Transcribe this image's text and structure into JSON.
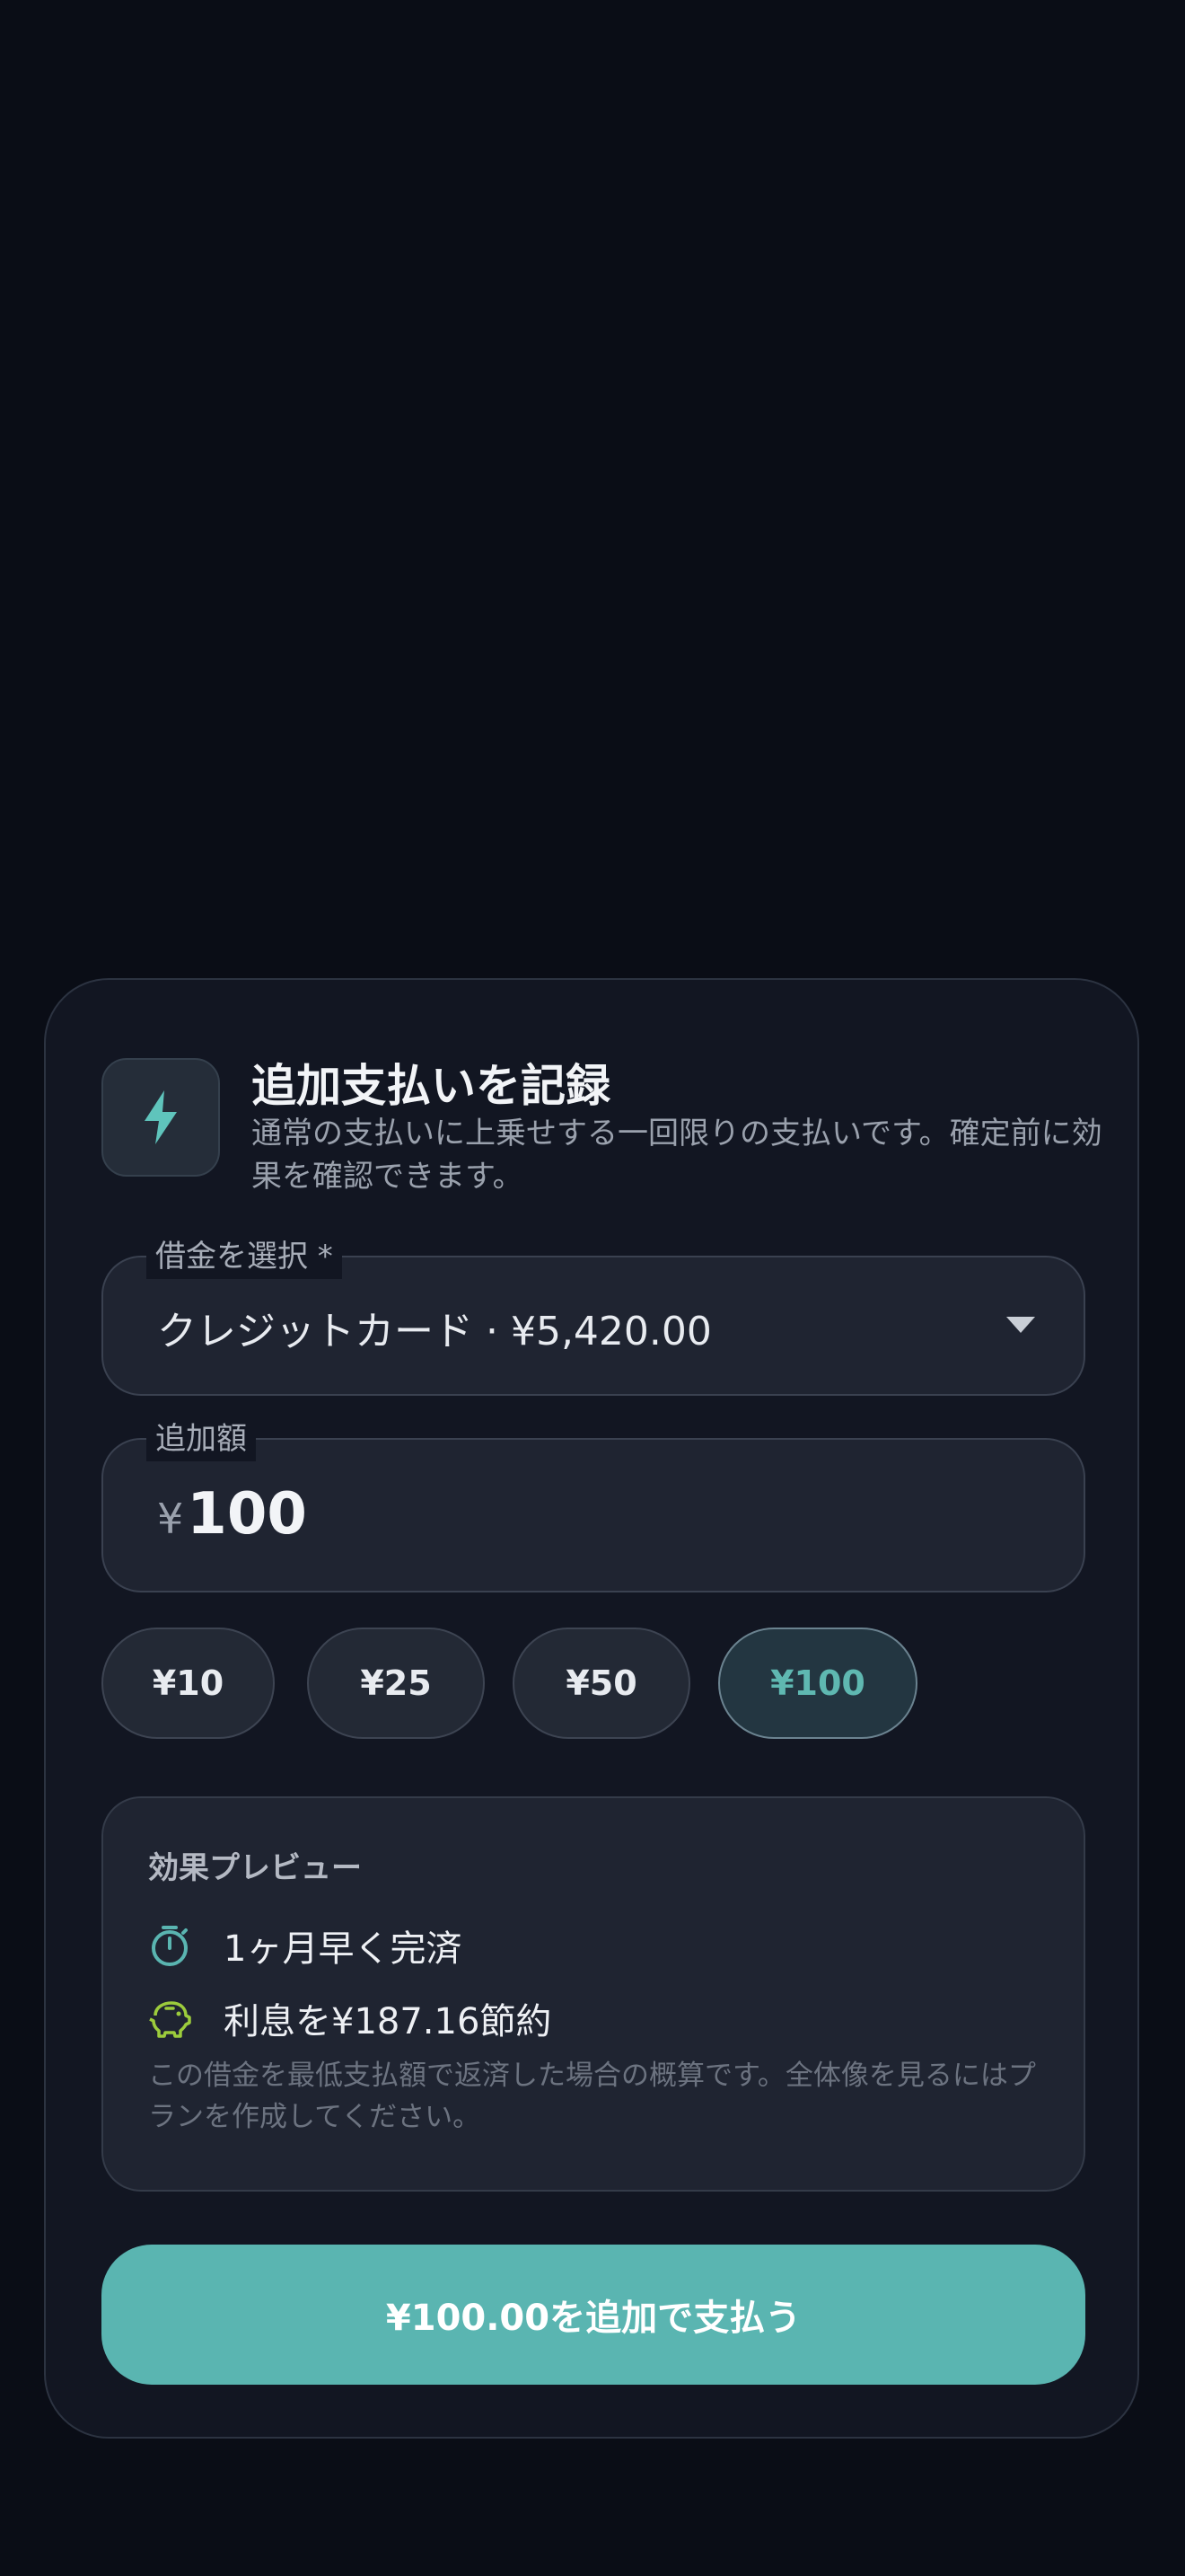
{
  "dialog": {
    "title": "追加支払いを記録",
    "subtitle": "通常の支払いに上乗せする一回限りの支払いです。確定前に効果を確認できます。",
    "icon": "bolt-icon",
    "accent_color": "#5ab5b1"
  },
  "loan_select": {
    "label": "借金を選択 *",
    "value": "クレジットカード · ¥5,420.00"
  },
  "amount_field": {
    "label": "追加額",
    "currency": "¥",
    "value": "100"
  },
  "quick_amounts": [
    {
      "label": "¥10",
      "selected": false
    },
    {
      "label": "¥25",
      "selected": false
    },
    {
      "label": "¥50",
      "selected": false
    },
    {
      "label": "¥100",
      "selected": true
    }
  ],
  "preview": {
    "title": "効果プレビュー",
    "effects": [
      {
        "icon": "timer-icon",
        "text": "1ヶ月早く完済"
      },
      {
        "icon": "piggy-bank-icon",
        "text": "利息を¥187.16節約"
      }
    ],
    "note": "この借金を最低支払額で返済した場合の概算です。全体像を見るにはプランを作成してください。"
  },
  "submit": {
    "label": "¥100.00を追加で支払う"
  }
}
